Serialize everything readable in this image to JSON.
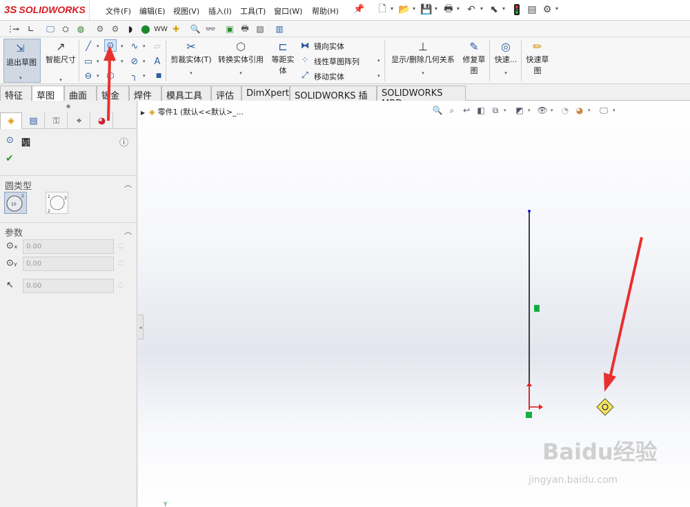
{
  "app": {
    "brand": "SOLIDWORKS",
    "brand_prefix": "3S"
  },
  "menu": {
    "items": [
      "文件(F)",
      "编辑(E)",
      "视图(V)",
      "插入(I)",
      "工具(T)",
      "窗口(W)",
      "帮助(H)"
    ]
  },
  "ribbon": {
    "exit_sketch": "退出草图",
    "smart_dim": "智能尺寸",
    "trim": "剪裁实体(T)",
    "convert": "转换实体引用",
    "offset_1": "等距实",
    "offset_2": "体",
    "mirror": "镜向实体",
    "linear_pattern": "线性草图阵列",
    "move": "移动实体",
    "display_relations": "显示/删除几何关系",
    "repair_1": "修复草",
    "repair_2": "图",
    "quick_snaps": "快速...",
    "quick_sketch_1": "快速草",
    "quick_sketch_2": "图"
  },
  "tabs": [
    "特征",
    "草图",
    "曲面",
    "钣金",
    "焊件",
    "模具工具",
    "评估",
    "DimXpert",
    "SOLIDWORKS 插件",
    "SOLIDWORKS MBD"
  ],
  "active_tab": "草图",
  "property_manager": {
    "title": "圆",
    "section_circle_type": "圆类型",
    "section_params": "参数",
    "center_x": "0.00",
    "center_y": "0.00",
    "radius": "0.00",
    "circle_type_icon_label": "10"
  },
  "viewport": {
    "tree_text": "零件1  (默认<<默认>_...",
    "y_axis_label": "Y"
  },
  "watermark": {
    "text": "Baidu经验",
    "url": "jingyan.baidu.com"
  },
  "colors": {
    "accent_red": "#e8302f",
    "brand_red": "#d71920",
    "sketch_line": "#111111",
    "endpoint_blue": "#1a1ad6",
    "relation_green": "#17b040"
  }
}
